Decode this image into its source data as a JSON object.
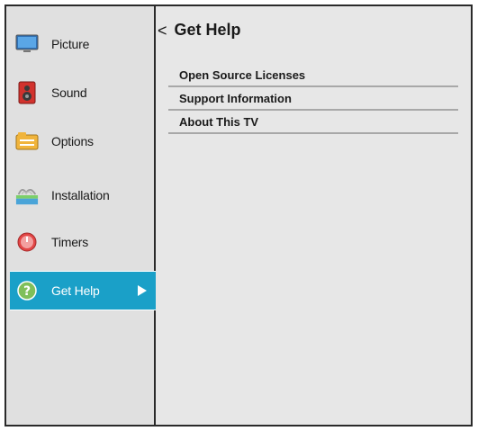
{
  "sidebar": {
    "items": [
      {
        "label": "Picture",
        "icon": "monitor-icon"
      },
      {
        "label": "Sound",
        "icon": "speaker-icon"
      },
      {
        "label": "Options",
        "icon": "options-folder-icon"
      },
      {
        "label": "Installation",
        "icon": "antenna-icon"
      },
      {
        "label": "Timers",
        "icon": "clock-icon"
      },
      {
        "label": "Get Help",
        "icon": "help-question-icon",
        "active": true
      }
    ]
  },
  "main": {
    "back_glyph": "<",
    "title": "Get Help",
    "options": [
      {
        "label": "Open Source Licenses"
      },
      {
        "label": "Support Information"
      },
      {
        "label": "About This TV"
      }
    ]
  },
  "colors": {
    "accent": "#1aa0c8",
    "background": "#e7e7e7",
    "divider": "#a8a8a8"
  }
}
